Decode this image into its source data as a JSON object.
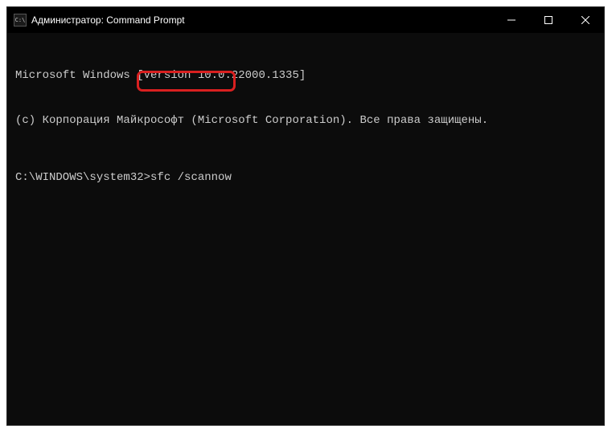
{
  "titlebar": {
    "icon_text": "C:\\",
    "title": "Администратор: Command Prompt"
  },
  "terminal": {
    "line1": "Microsoft Windows [Version 10.0.22000.1335]",
    "line2": "(c) Корпорация Майкрософт (Microsoft Corporation). Все права защищены.",
    "prompt": "C:\\WINDOWS\\system32>",
    "command": "sfc /scannow"
  }
}
